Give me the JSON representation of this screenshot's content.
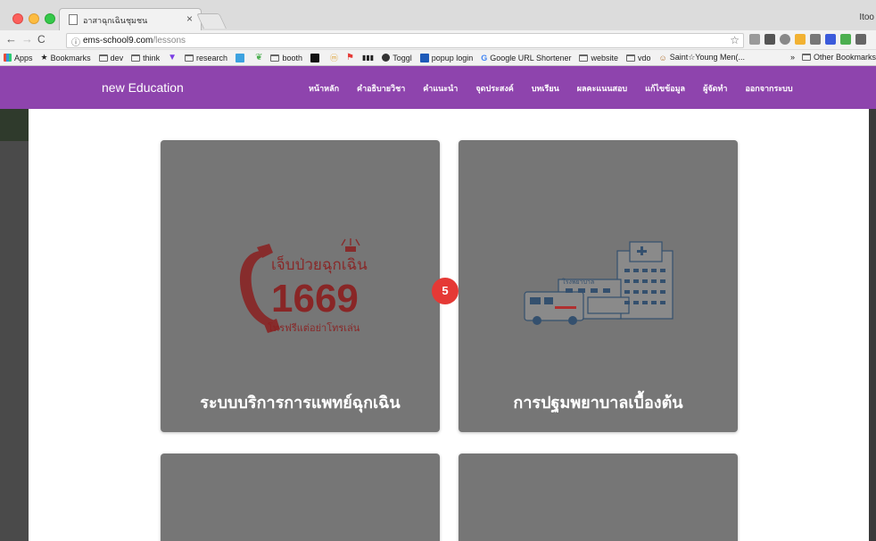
{
  "browser": {
    "tab_title": "อาสาฉุกเฉินชุมชน",
    "tab_close": "×",
    "profile_name": "Itoo",
    "url_host": "ems-school9.com",
    "url_path": "/lessons",
    "nav_back": "←",
    "nav_forward": "→",
    "nav_reload": "C",
    "info_icon": "ⓘ",
    "star_icon": "☆",
    "bookmarks": [
      {
        "label": "Apps",
        "icon": "apps-icon"
      },
      {
        "label": "Bookmarks",
        "icon": "star-icon"
      },
      {
        "label": "dev",
        "icon": "folder-icon"
      },
      {
        "label": "think",
        "icon": "folder-icon"
      },
      {
        "label": "",
        "icon": "triangle-icon"
      },
      {
        "label": "research",
        "icon": "folder-icon"
      },
      {
        "label": "",
        "icon": "blue-square-icon"
      },
      {
        "label": "",
        "icon": "leaf-icon"
      },
      {
        "label": "booth",
        "icon": "folder-icon"
      },
      {
        "label": "",
        "icon": "black-a-icon"
      },
      {
        "label": "",
        "icon": "m-icon"
      },
      {
        "label": "",
        "icon": "flag-icon"
      },
      {
        "label": "",
        "icon": "bars-icon"
      },
      {
        "label": "Toggl",
        "icon": "toggl-icon"
      },
      {
        "label": "popup login",
        "icon": "h-icon"
      },
      {
        "label": "Google URL Shortener",
        "icon": "google-icon"
      },
      {
        "label": "website",
        "icon": "folder-icon"
      },
      {
        "label": "vdo",
        "icon": "folder-icon"
      },
      {
        "label": "Saint☆Young Men(...",
        "icon": "character-icon"
      }
    ],
    "other_bookmarks": "Other Bookmarks",
    "overflow": "»"
  },
  "site": {
    "brand": "new Education",
    "menu": [
      "หน้าหลัก",
      "คำอธิบายวิชา",
      "คำแนะนำ",
      "จุดประสงค์",
      "บทเรียน",
      "ผลคะแนนสอบ",
      "แก้ไขข้อมูล",
      "ผู้จัดทำ",
      "ออกจากระบบ"
    ]
  },
  "lessons": {
    "cards": [
      {
        "title": "ระบบบริการการแพทย์ฉุกเฉิน",
        "image_icon": "hotline-1669-icon",
        "logo_text_top": "เจ็บป่วยฉุกเฉิน",
        "logo_number": "1669",
        "logo_text_bottom": "โทรฟรีแต่อย่าโทรเล่น"
      },
      {
        "title": "การปฐมพยาบาลเบื้องต้น",
        "image_icon": "hospital-ambulance-icon",
        "logo_label": "โรงพยาบาล"
      },
      {
        "title": "",
        "image_icon": ""
      },
      {
        "title": "",
        "image_icon": ""
      }
    ],
    "badge": "5"
  },
  "colors": {
    "navbar": "#8e44ad",
    "card": "#767676",
    "badge": "#e53935",
    "logo_red": "#8b2020"
  }
}
